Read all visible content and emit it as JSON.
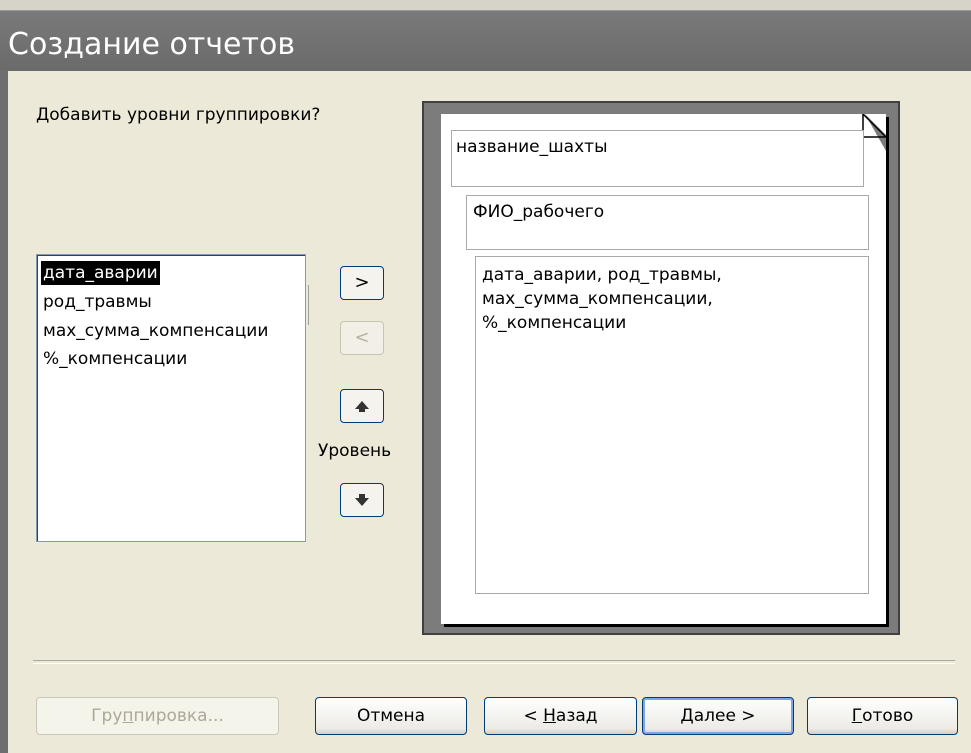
{
  "window": {
    "title": "Создание отчетов"
  },
  "prompt": "Добавить уровни группировки?",
  "fields": [
    "дата_аварии",
    "род_травмы",
    "мах_сумма_компенсации",
    "%_компенсации"
  ],
  "selected_field_index": 0,
  "transfer": {
    "add_label": ">",
    "remove_label": "<",
    "level_label": "Уровень"
  },
  "preview": {
    "group1": "название_шахты",
    "group2": "ФИО_рабочего",
    "detail_lines": [
      "дата_аварии, род_травмы,",
      "мах_сумма_компенсации,",
      "%_компенсации"
    ]
  },
  "buttons": {
    "grouping": {
      "pre": "Гру",
      "mnemonic": "п",
      "post": "пировка..."
    },
    "cancel": "Отмена",
    "back": {
      "pre": "< ",
      "mnemonic": "Н",
      "post": "азад"
    },
    "next": {
      "pre": "",
      "mnemonic": "Д",
      "post": "алее >"
    },
    "finish": {
      "pre": "",
      "mnemonic": "Г",
      "post": "отово"
    }
  },
  "colors": {
    "title_bar": "#6f6f6f",
    "dialog_bg": "#ece9d8",
    "accent_border": "#003c74",
    "selection": "#000000"
  }
}
